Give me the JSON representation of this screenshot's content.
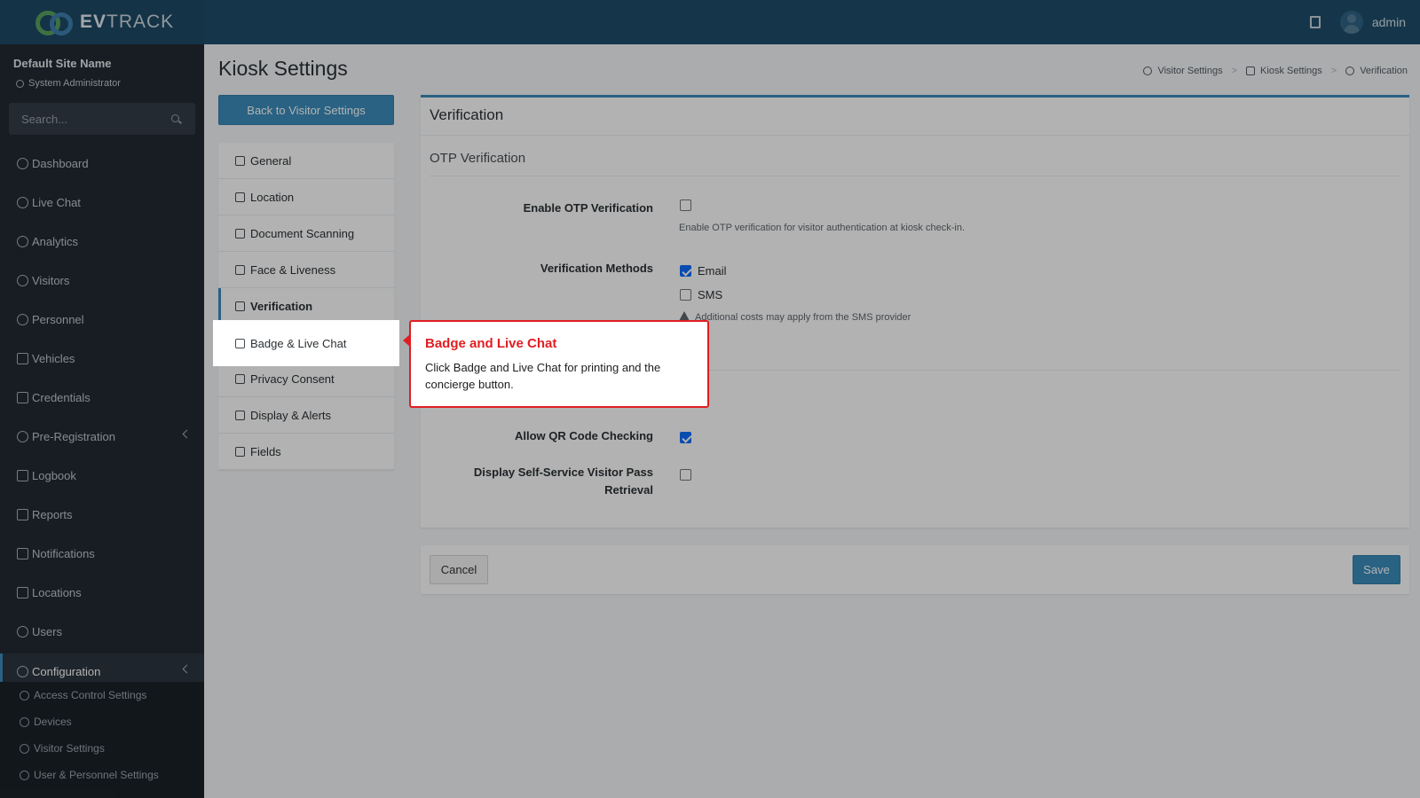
{
  "brand": {
    "name_bold": "EV",
    "name_rest": "TRACK"
  },
  "topbar": {
    "user": "admin",
    "icon": "building-icon"
  },
  "sidebar": {
    "site_name": "Default Site Name",
    "role": "System Administrator",
    "search_placeholder": "Search...",
    "items": [
      {
        "label": "Dashboard",
        "icon": "dashboard-icon"
      },
      {
        "label": "Live Chat",
        "icon": "headset-icon"
      },
      {
        "label": "Analytics",
        "icon": "analytics-icon"
      },
      {
        "label": "Visitors",
        "icon": "eye-icon"
      },
      {
        "label": "Personnel",
        "icon": "personnel-icon"
      },
      {
        "label": "Vehicles",
        "icon": "car-icon"
      },
      {
        "label": "Credentials",
        "icon": "credentials-icon"
      },
      {
        "label": "Pre-Registration",
        "icon": "swap-icon"
      },
      {
        "label": "Logbook",
        "icon": "book-icon"
      },
      {
        "label": "Reports",
        "icon": "reports-icon"
      },
      {
        "label": "Notifications",
        "icon": "chat-icon"
      },
      {
        "label": "Locations",
        "icon": "map-icon"
      },
      {
        "label": "Users",
        "icon": "users-icon"
      },
      {
        "label": "Configuration",
        "icon": "gear-icon"
      }
    ],
    "submenu": [
      {
        "label": "Access Control Settings",
        "icon": "lock-icon"
      },
      {
        "label": "Devices",
        "icon": "devices-icon"
      },
      {
        "label": "Visitor Settings",
        "icon": "eye-icon"
      },
      {
        "label": "User & Personnel Settings",
        "icon": "users-icon"
      }
    ]
  },
  "page": {
    "title": "Kiosk Settings",
    "breadcrumb": [
      "Visitor Settings",
      "Kiosk Settings",
      "Verification"
    ],
    "back_button": "Back to Visitor Settings"
  },
  "menu": [
    {
      "label": "General",
      "icon": "sliders-icon"
    },
    {
      "label": "Location",
      "icon": "location-pin-icon"
    },
    {
      "label": "Document Scanning",
      "icon": "scan-icon"
    },
    {
      "label": "Face & Liveness",
      "icon": "face-icon"
    },
    {
      "label": "Verification",
      "icon": "shield-check-icon"
    },
    {
      "label": "Badge & Live Chat",
      "icon": "badge-icon"
    },
    {
      "label": "Privacy Consent",
      "icon": "shield-icon"
    },
    {
      "label": "Display & Alerts",
      "icon": "display-icon"
    },
    {
      "label": "Fields",
      "icon": "list-check-icon"
    }
  ],
  "panel": {
    "title": "Verification",
    "section": "OTP Verification",
    "enable_otp_label": "Enable OTP Verification",
    "enable_otp_checked": false,
    "enable_otp_help": "Enable OTP verification for visitor authentication at kiosk check-in.",
    "methods_label": "Verification Methods",
    "method_email": "Email",
    "method_email_checked": true,
    "method_sms": "SMS",
    "method_sms_checked": false,
    "sms_warning": "Additional costs may apply from the SMS provider",
    "qr_label": "Allow QR Code Checking",
    "qr_checked": true,
    "selfservice_label_1": "Display Self-Service Visitor Pass",
    "selfservice_label_2": "Retrieval",
    "selfservice_checked": false
  },
  "footer": {
    "cancel": "Cancel",
    "save": "Save"
  },
  "tooltip": {
    "title": "Badge and Live Chat",
    "body": "Click Badge and Live Chat for printing and the concierge button."
  },
  "colors": {
    "accent": "#3c8dbc",
    "topbar": "#1f4e6b",
    "sidebar": "#222a33",
    "tooltip_red": "#e01e22"
  }
}
